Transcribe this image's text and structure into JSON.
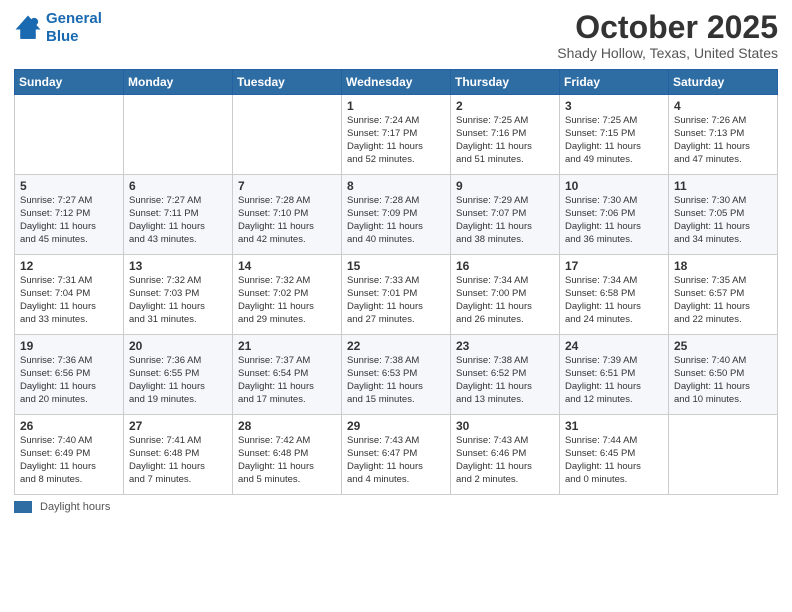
{
  "header": {
    "logo_line1": "General",
    "logo_line2": "Blue",
    "title": "October 2025",
    "subtitle": "Shady Hollow, Texas, United States"
  },
  "weekdays": [
    "Sunday",
    "Monday",
    "Tuesday",
    "Wednesday",
    "Thursday",
    "Friday",
    "Saturday"
  ],
  "footer": {
    "legend_label": "Daylight hours"
  },
  "weeks": [
    [
      {
        "day": "",
        "info": ""
      },
      {
        "day": "",
        "info": ""
      },
      {
        "day": "",
        "info": ""
      },
      {
        "day": "1",
        "info": "Sunrise: 7:24 AM\nSunset: 7:17 PM\nDaylight: 11 hours\nand 52 minutes."
      },
      {
        "day": "2",
        "info": "Sunrise: 7:25 AM\nSunset: 7:16 PM\nDaylight: 11 hours\nand 51 minutes."
      },
      {
        "day": "3",
        "info": "Sunrise: 7:25 AM\nSunset: 7:15 PM\nDaylight: 11 hours\nand 49 minutes."
      },
      {
        "day": "4",
        "info": "Sunrise: 7:26 AM\nSunset: 7:13 PM\nDaylight: 11 hours\nand 47 minutes."
      }
    ],
    [
      {
        "day": "5",
        "info": "Sunrise: 7:27 AM\nSunset: 7:12 PM\nDaylight: 11 hours\nand 45 minutes."
      },
      {
        "day": "6",
        "info": "Sunrise: 7:27 AM\nSunset: 7:11 PM\nDaylight: 11 hours\nand 43 minutes."
      },
      {
        "day": "7",
        "info": "Sunrise: 7:28 AM\nSunset: 7:10 PM\nDaylight: 11 hours\nand 42 minutes."
      },
      {
        "day": "8",
        "info": "Sunrise: 7:28 AM\nSunset: 7:09 PM\nDaylight: 11 hours\nand 40 minutes."
      },
      {
        "day": "9",
        "info": "Sunrise: 7:29 AM\nSunset: 7:07 PM\nDaylight: 11 hours\nand 38 minutes."
      },
      {
        "day": "10",
        "info": "Sunrise: 7:30 AM\nSunset: 7:06 PM\nDaylight: 11 hours\nand 36 minutes."
      },
      {
        "day": "11",
        "info": "Sunrise: 7:30 AM\nSunset: 7:05 PM\nDaylight: 11 hours\nand 34 minutes."
      }
    ],
    [
      {
        "day": "12",
        "info": "Sunrise: 7:31 AM\nSunset: 7:04 PM\nDaylight: 11 hours\nand 33 minutes."
      },
      {
        "day": "13",
        "info": "Sunrise: 7:32 AM\nSunset: 7:03 PM\nDaylight: 11 hours\nand 31 minutes."
      },
      {
        "day": "14",
        "info": "Sunrise: 7:32 AM\nSunset: 7:02 PM\nDaylight: 11 hours\nand 29 minutes."
      },
      {
        "day": "15",
        "info": "Sunrise: 7:33 AM\nSunset: 7:01 PM\nDaylight: 11 hours\nand 27 minutes."
      },
      {
        "day": "16",
        "info": "Sunrise: 7:34 AM\nSunset: 7:00 PM\nDaylight: 11 hours\nand 26 minutes."
      },
      {
        "day": "17",
        "info": "Sunrise: 7:34 AM\nSunset: 6:58 PM\nDaylight: 11 hours\nand 24 minutes."
      },
      {
        "day": "18",
        "info": "Sunrise: 7:35 AM\nSunset: 6:57 PM\nDaylight: 11 hours\nand 22 minutes."
      }
    ],
    [
      {
        "day": "19",
        "info": "Sunrise: 7:36 AM\nSunset: 6:56 PM\nDaylight: 11 hours\nand 20 minutes."
      },
      {
        "day": "20",
        "info": "Sunrise: 7:36 AM\nSunset: 6:55 PM\nDaylight: 11 hours\nand 19 minutes."
      },
      {
        "day": "21",
        "info": "Sunrise: 7:37 AM\nSunset: 6:54 PM\nDaylight: 11 hours\nand 17 minutes."
      },
      {
        "day": "22",
        "info": "Sunrise: 7:38 AM\nSunset: 6:53 PM\nDaylight: 11 hours\nand 15 minutes."
      },
      {
        "day": "23",
        "info": "Sunrise: 7:38 AM\nSunset: 6:52 PM\nDaylight: 11 hours\nand 13 minutes."
      },
      {
        "day": "24",
        "info": "Sunrise: 7:39 AM\nSunset: 6:51 PM\nDaylight: 11 hours\nand 12 minutes."
      },
      {
        "day": "25",
        "info": "Sunrise: 7:40 AM\nSunset: 6:50 PM\nDaylight: 11 hours\nand 10 minutes."
      }
    ],
    [
      {
        "day": "26",
        "info": "Sunrise: 7:40 AM\nSunset: 6:49 PM\nDaylight: 11 hours\nand 8 minutes."
      },
      {
        "day": "27",
        "info": "Sunrise: 7:41 AM\nSunset: 6:48 PM\nDaylight: 11 hours\nand 7 minutes."
      },
      {
        "day": "28",
        "info": "Sunrise: 7:42 AM\nSunset: 6:48 PM\nDaylight: 11 hours\nand 5 minutes."
      },
      {
        "day": "29",
        "info": "Sunrise: 7:43 AM\nSunset: 6:47 PM\nDaylight: 11 hours\nand 4 minutes."
      },
      {
        "day": "30",
        "info": "Sunrise: 7:43 AM\nSunset: 6:46 PM\nDaylight: 11 hours\nand 2 minutes."
      },
      {
        "day": "31",
        "info": "Sunrise: 7:44 AM\nSunset: 6:45 PM\nDaylight: 11 hours\nand 0 minutes."
      },
      {
        "day": "",
        "info": ""
      }
    ]
  ]
}
